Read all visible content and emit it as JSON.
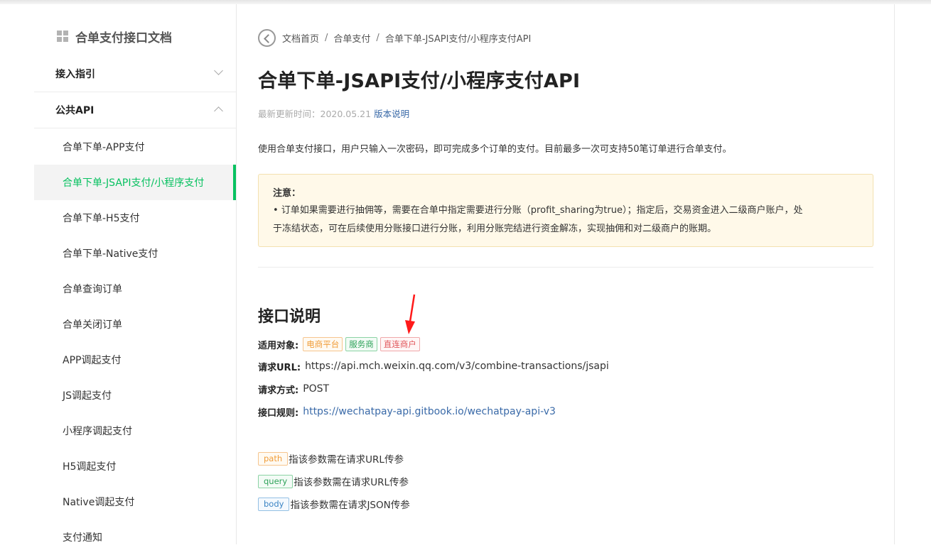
{
  "sidebar": {
    "title": "合单支付接口文档",
    "groups": [
      {
        "label": "接入指引"
      },
      {
        "label": "公共API"
      }
    ],
    "items": [
      {
        "label": "合单下单-APP支付"
      },
      {
        "label": "合单下单-JSAPI支付/小程序支付"
      },
      {
        "label": "合单下单-H5支付"
      },
      {
        "label": "合单下单-Native支付"
      },
      {
        "label": "合单查询订单"
      },
      {
        "label": "合单关闭订单"
      },
      {
        "label": "APP调起支付"
      },
      {
        "label": "JS调起支付"
      },
      {
        "label": "小程序调起支付"
      },
      {
        "label": "H5调起支付"
      },
      {
        "label": "Native调起支付"
      },
      {
        "label": "支付通知"
      }
    ],
    "active_index": 1
  },
  "breadcrumb": {
    "items": [
      "文档首页",
      "合单支付",
      "合单下单-JSAPI支付/小程序支付API"
    ],
    "separator": "/"
  },
  "main": {
    "title": "合单下单-JSAPI支付/小程序支付API",
    "updated_label": "最新更新时间：2020.05.21",
    "version_link": "版本说明",
    "description": "使用合单支付接口，用户只输入一次密码，即可完成多个订单的支付。目前最多一次可支持50笔订单进行合单支付。",
    "notice": {
      "title": "注意：",
      "line1": "• 订单如果需要进行抽佣等，需要在合单中指定需要进行分账（profit_sharing为true）；指定后，交易资金进入二级商户账户，处",
      "line2": "于冻结状态，可在后续使用分账接口进行分账，利用分账完结进行资金解冻，实现抽佣和对二级商户的账期。"
    },
    "section_title": "接口说明",
    "applicable_label": "适用对象:",
    "applicable_tags": [
      "电商平台",
      "服务商",
      "直连商户"
    ],
    "url_label": "请求URL:",
    "url_value": "https://api.mch.weixin.qq.com/v3/combine-transactions/jsapi",
    "method_label": "请求方式:",
    "method_value": "POST",
    "rules_label": "接口规则:",
    "rules_link": "https://wechatpay-api.gitbook.io/wechatpay-api-v3",
    "params": [
      {
        "tag": "path",
        "text": "指该参数需在请求URL传参"
      },
      {
        "tag": "query",
        "text": "指该参数需在请求URL传参"
      },
      {
        "tag": "body",
        "text": "指该参数需在请求JSON传参"
      }
    ]
  },
  "colors": {
    "accent_green": "#07c160",
    "link_blue": "#3a6aa8",
    "annotation_arrow": "#ff1a1a"
  }
}
